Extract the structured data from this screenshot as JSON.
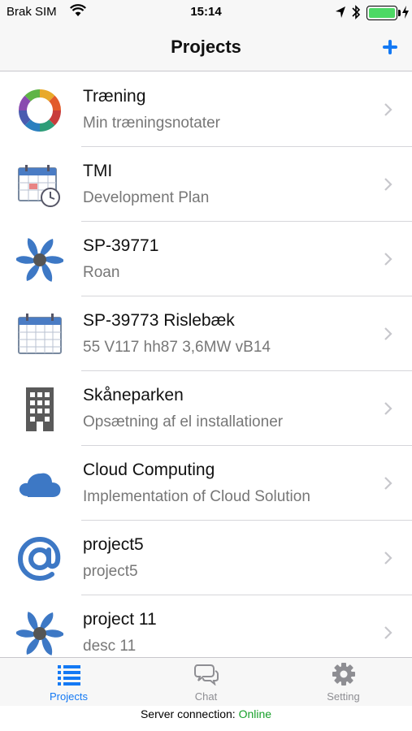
{
  "status_bar": {
    "carrier": "Brak SIM",
    "time": "15:14",
    "battery_level": 1.0,
    "battery_color": "#4cd964"
  },
  "nav": {
    "title": "Projects",
    "add_icon": "plus-icon",
    "accent": "#1479f4"
  },
  "projects": [
    {
      "title": "Træning",
      "subtitle": "Min træningsnotater",
      "icon": "color-wheel-icon"
    },
    {
      "title": "TMI",
      "subtitle": "Development Plan",
      "icon": "calendar-clock-icon"
    },
    {
      "title": "SP-39771",
      "subtitle": "Roan",
      "icon": "fan-icon"
    },
    {
      "title": "SP-39773 Rislebæk",
      "subtitle": "55 V117 hh87 3,6MW vB14",
      "icon": "calendar-icon"
    },
    {
      "title": "Skåneparken",
      "subtitle": "Opsætning af el installationer",
      "icon": "building-icon"
    },
    {
      "title": "Cloud Computing",
      "subtitle": "Implementation of Cloud Solution",
      "icon": "cloud-icon"
    },
    {
      "title": "project5",
      "subtitle": "project5",
      "icon": "at-sign-icon"
    },
    {
      "title": "project 11",
      "subtitle": "desc 11",
      "icon": "fan-icon"
    }
  ],
  "tabs": [
    {
      "label": "Projects",
      "icon": "list-icon",
      "active": true
    },
    {
      "label": "Chat",
      "icon": "chat-bubbles-icon",
      "active": false
    },
    {
      "label": "Setting",
      "icon": "gear-icon",
      "active": false
    }
  ],
  "server": {
    "label": "Server connection:",
    "status": "Online",
    "status_color": "#17a02a"
  }
}
